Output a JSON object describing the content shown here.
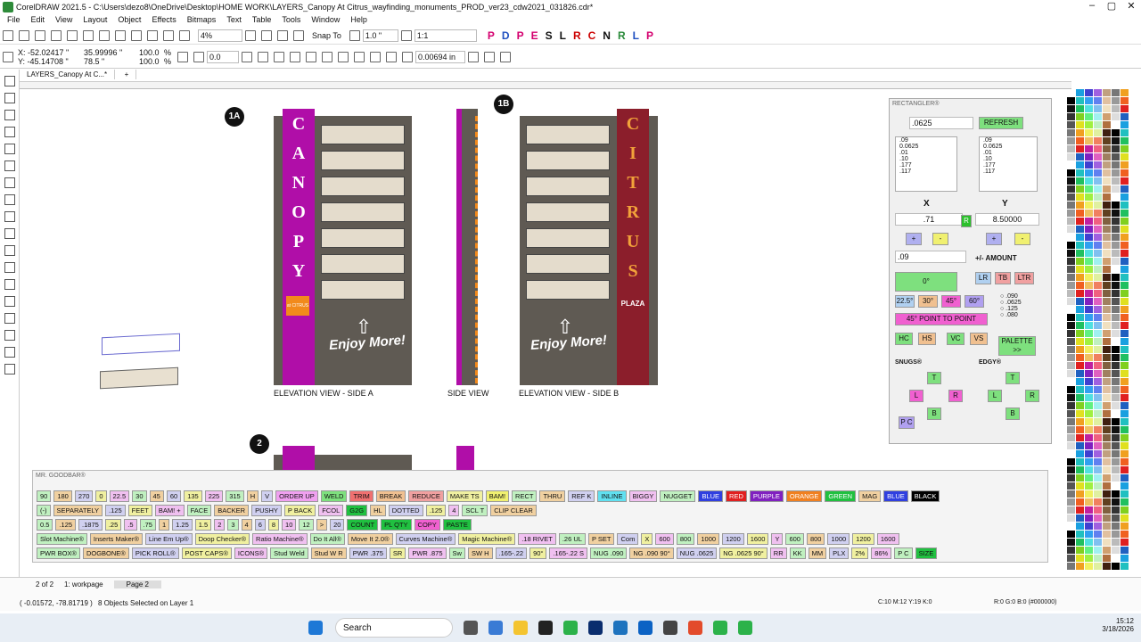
{
  "title": "CorelDRAW 2021.5 - C:\\Users\\dezo8\\OneDrive\\Desktop\\HOME WORK\\LAYERS_Canopy At Citrus_wayfinding_monuments_PROD_ver23_cdw2021_031826.cdr*",
  "menu": [
    "File",
    "Edit",
    "View",
    "Layout",
    "Object",
    "Effects",
    "Bitmaps",
    "Text",
    "Table",
    "Tools",
    "Window",
    "Help"
  ],
  "toolbar": {
    "zoom": "4%",
    "snap": "Snap To",
    "nudge": "1.0 \"",
    "scale": "1:1"
  },
  "props": {
    "x": "X: -52.02417 \"",
    "y": "Y: -45.14708 \"",
    "w": "35.99996 \"",
    "h": "78.5 \"",
    "sx": "100.0",
    "sy": "100.0",
    "pct": "%",
    "rot": "0.0",
    "outline": "0.00694 in"
  },
  "brand_letters": [
    "P",
    "D",
    "P",
    "E",
    "S",
    "L",
    "R",
    "C",
    "N",
    "R",
    "L",
    "P"
  ],
  "doc_tab": "LAYERS_Canopy At C...*",
  "canvas": {
    "badge_1a": "1A",
    "badge_1b": "1B",
    "badge_2": "2",
    "canopy_letters": [
      "C",
      "A",
      "N",
      "O",
      "P",
      "Y"
    ],
    "citrus_letters": [
      "C",
      "I",
      "T",
      "R",
      "U",
      "S"
    ],
    "plaza": "PLAZA",
    "at_citrus": "at CITRUS",
    "enjoy": "Enjoy More!",
    "cap_a": "ELEVATION VIEW - SIDE A",
    "cap_side": "SIDE VIEW",
    "cap_b": "ELEVATION VIEW - SIDE B"
  },
  "rectangler": {
    "title": "RECTANGLER®",
    "size": ".0625",
    "refresh": "REFRESH",
    "list1": [
      ".09",
      "0.0625",
      ".01",
      ".10",
      ".177",
      ".117"
    ],
    "list2": [
      ".09",
      "0.0625",
      ".01",
      ".10",
      ".177",
      ".117"
    ],
    "x_label": "X",
    "y_label": "Y",
    "x_val": ".71",
    "y_val": "8.50000",
    "r": "R",
    "amount_val": ".09",
    "amount_label": "+/- AMOUNT",
    "deg": "0°",
    "lr": "LR",
    "tb": "TB",
    "ltr": "LTR",
    "angles": [
      "22.5°",
      "30°",
      "45°",
      "60°"
    ],
    "p2p": "45° POINT TO POINT",
    "opts": [
      ".090",
      ".0625",
      ".125",
      ".080"
    ],
    "hc": "HC",
    "hs": "HS",
    "vc": "VC",
    "vs": "VS",
    "palette": "PALETTE >>",
    "snugs": "SNUGS®",
    "edgy": "EDGY®",
    "pc": "P C"
  },
  "goodbar": {
    "title": "MR. GOODBAR®",
    "row1": [
      "90",
      "180",
      "270",
      "0",
      "22.5",
      "30",
      "45",
      "60",
      "135",
      "225",
      "315",
      "H",
      "V",
      "ORDER UP",
      "WELD",
      "TRIM",
      "BREAK",
      "REDUCE",
      "MAKE TS",
      "BAM!",
      "RECT",
      "THRU",
      "REF K",
      "INLINE",
      "BIGGY",
      "NUGGET",
      "BLUE",
      "RED",
      "PURPLE",
      "ORANGE",
      "GREEN",
      "MAG",
      "BLUE",
      "BLACK"
    ],
    "row2": [
      "(-)",
      "SEPARATELY",
      ".125",
      "FEET",
      "BAM! +",
      "FACE",
      "BACKER",
      "PUSHY",
      "P BACK",
      "FCOL",
      "G2G",
      "HL",
      "DOTTED",
      ".125",
      "4",
      "SCL T",
      "CLIP CLEAR"
    ],
    "row3": [
      "0.5",
      ".125",
      ".1875",
      ".25",
      ".5",
      ".75",
      "1",
      "1.25",
      "1.5",
      "2",
      "3",
      "4",
      "6",
      "8",
      "10",
      "12",
      ">",
      "20",
      "COUNT",
      "PL QTY",
      "COPY",
      "PASTE"
    ],
    "row4": [
      "Slot Machine®",
      "Inserts Maker®",
      "Line Em Up®",
      "Doop Checker®",
      "Ratio Machine®",
      "Do It All®",
      "Move It 2.0®",
      "Curves Machine®",
      "Magic Machine®",
      ".18 RIVET",
      ".26 UL",
      "P SET",
      "Com",
      "X",
      "600",
      "800",
      "1000",
      "1200",
      "1600",
      "Y",
      "600",
      "800",
      "1000",
      "1200",
      "1600"
    ],
    "row5": [
      "PWR BOX®",
      "DOGBONE®",
      "PICK ROLL®",
      "POST CAPS®",
      "ICONS®",
      "Stud Weld",
      "Stud W R",
      "PWR .375",
      "SR",
      "PWR .875",
      "Sw",
      "SW H",
      ".165-.22",
      "90°",
      ".165-.22 S",
      "NUG .090",
      "NG .090 90°",
      "NUG .0625",
      "NG .0625 90°",
      "RR",
      "KK",
      "MM",
      "PLX",
      "2%",
      "86%",
      "P C",
      "SIZE"
    ]
  },
  "status": {
    "page_info": "2 of 2",
    "page1": "1: workpage",
    "page2": "Page 2",
    "coords": "( -0.01572, -78.81719 )",
    "selection": "8 Objects Selected on Layer 1",
    "fill": "C:10 M:12 Y:19 K:0",
    "outline": "R:0 G:0 B:0 (#000000)"
  },
  "taskbar": {
    "search": "Search",
    "time": "15:12",
    "date": "3/18/2026"
  },
  "colors": {
    "magenta": "#b00ea8",
    "dark": "#5f5a53",
    "citrus": "#8b1e2b",
    "panel": "#e4dccc"
  }
}
